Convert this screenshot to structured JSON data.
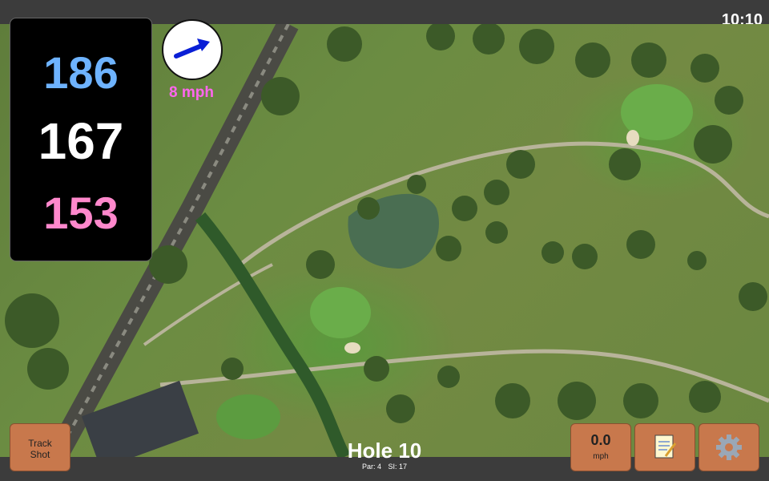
{
  "status_bar": {
    "time": "10:10"
  },
  "distances": {
    "back": "186",
    "middle": "167",
    "front": "153"
  },
  "wind": {
    "speed_label": "8 mph",
    "icon": "wind-arrow-icon"
  },
  "bottom": {
    "track_shot": {
      "line1": "Track",
      "line2": "Shot"
    },
    "speed": {
      "value": "0.0",
      "unit": "mph"
    },
    "notes_icon": "notepad-icon",
    "settings_icon": "gear-icon"
  },
  "hole": {
    "title": "Hole 10",
    "par_label": "Par: 4",
    "si_label": "SI: 17"
  },
  "colors": {
    "back": "#6eb3ff",
    "middle": "#ffffff",
    "front": "#ff88cc",
    "wind": "#ff66ee",
    "button": "#c8784c"
  }
}
